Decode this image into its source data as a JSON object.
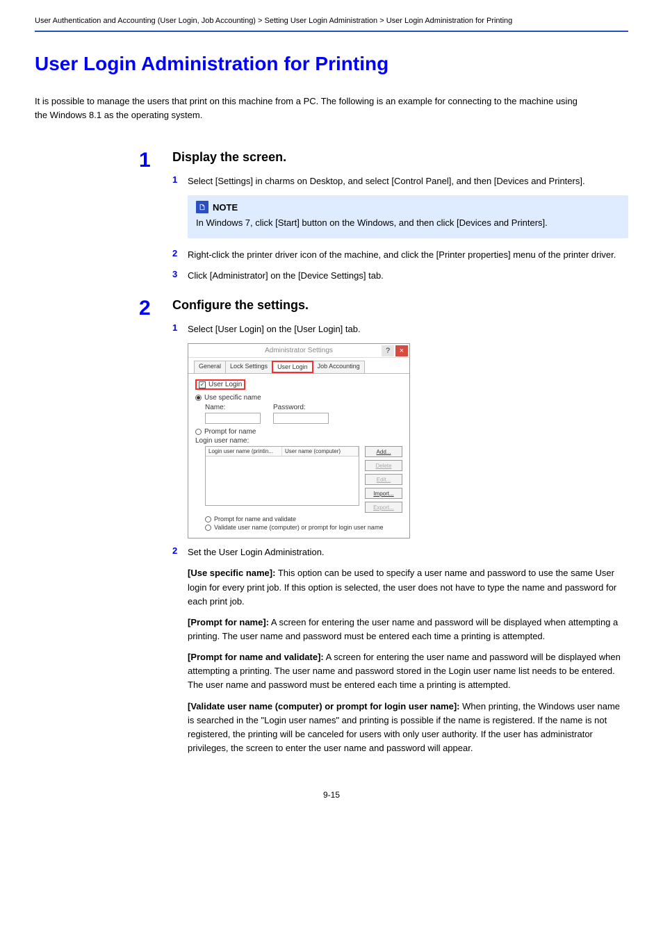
{
  "header": {
    "breadcrumb": "User Authentication and Accounting (User Login, Job Accounting) > Setting User Login Administration > User Login Administration for Printing",
    "page_number": "9-15"
  },
  "page_title": "User Login Administration for Printing",
  "intro": "It is possible to manage the users that print on this machine from a PC. The following is an example for connecting to the machine using the Windows 8.1 as the operating system.",
  "step1": {
    "number": "1",
    "title": "Display the screen.",
    "sub1_intro": "Select [Settings] in charms on Desktop, and select [Control Panel], and then [Devices and Printers].",
    "note_title": "NOTE",
    "note_body": "In Windows 7, click [Start] button on the Windows, and then click [Devices and Printers].",
    "sub2": "Right-click the printer driver icon of the machine, and click the [Printer properties] menu of the printer driver.",
    "sub3": "Click [Administrator] on the [Device Settings] tab."
  },
  "step2": {
    "number": "2",
    "title": "Configure the settings.",
    "sub1": "Select [User Login] on the [User Login] tab.",
    "sub2_num": "2",
    "sub2_intro": "Set the User Login Administration.",
    "use_specific": {
      "label": "[Use specific name]:",
      "text": " This option can be used to specify a user name and password to use the same User login for every print job. If this option is selected, the user does not have to type the name and password for each print job."
    },
    "prompt_name": {
      "label": "[Prompt for name]:",
      "text": " A screen for entering the user name and password will be displayed when attempting a printing. The user name and password must be entered each time a printing is attempted."
    },
    "prompt_validate": {
      "label": "[Prompt for name and validate]:",
      "text": " A screen for entering the user name and password will be displayed when attempting a printing. The user name and password stored in the Login user name list needs to be entered. The user name and password must be entered each time a printing is attempted."
    },
    "validate": {
      "label": "[Validate user name (computer) or prompt for login user name]:",
      "text": " When printing, the Windows user name is searched in the \"Login user names\" and printing is possible if the name is registered. If the name is not registered, the printing will be canceled for users with only user authority. If the user has administrator privileges, the screen to enter the user name and password will appear."
    }
  },
  "dialog": {
    "titlebar": "Administrator Settings",
    "help": "?",
    "close": "×",
    "tabs": {
      "general": "General",
      "lock": "Lock Settings",
      "user_login": "User Login",
      "job_acc": "Job Accounting"
    },
    "user_login_checkbox": "User Login",
    "use_specific_name": "Use specific name",
    "name_label": "Name:",
    "password_label": "Password:",
    "prompt_for_name": "Prompt for name",
    "login_user_name_label": "Login user name:",
    "col1": "Login user name (printin...",
    "col2": "User name (computer)",
    "buttons": {
      "add": "Add...",
      "delete": "Delete",
      "edit": "Edit...",
      "import": "Import...",
      "export": "Export..."
    },
    "radio_prompt_validate": "Prompt for name and validate",
    "radio_validate": "Validate user name (computer) or prompt for login user name"
  }
}
